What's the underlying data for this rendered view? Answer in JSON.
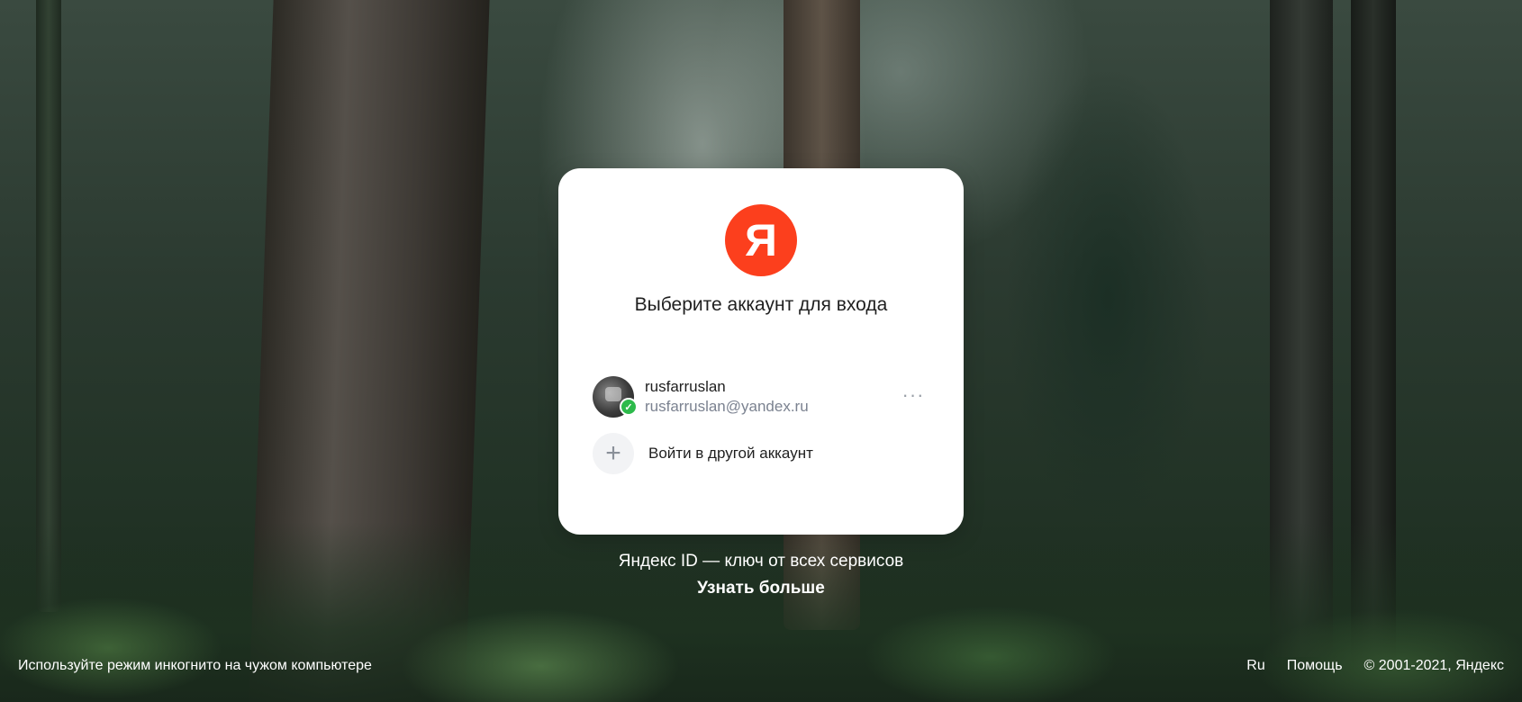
{
  "brand": {
    "logo_letter": "Я",
    "logo_color": "#fc3f1d"
  },
  "card": {
    "title": "Выберите аккаунт для входа",
    "account": {
      "name": "rusfarruslan",
      "email": "rusfarruslan@yandex.ru",
      "verified_icon": "check-icon",
      "more_label": "···"
    },
    "add_account": {
      "icon": "plus-icon",
      "label": "Войти в другой аккаунт"
    }
  },
  "promo": {
    "tagline": "Яндекс ID — ключ от всех сервисов",
    "learn_more": "Узнать больше"
  },
  "footer": {
    "incognito_hint": "Используйте режим инкогнито на чужом компьютере",
    "language": "Ru",
    "help": "Помощь",
    "copyright": "© 2001-2021, Яндекс"
  }
}
